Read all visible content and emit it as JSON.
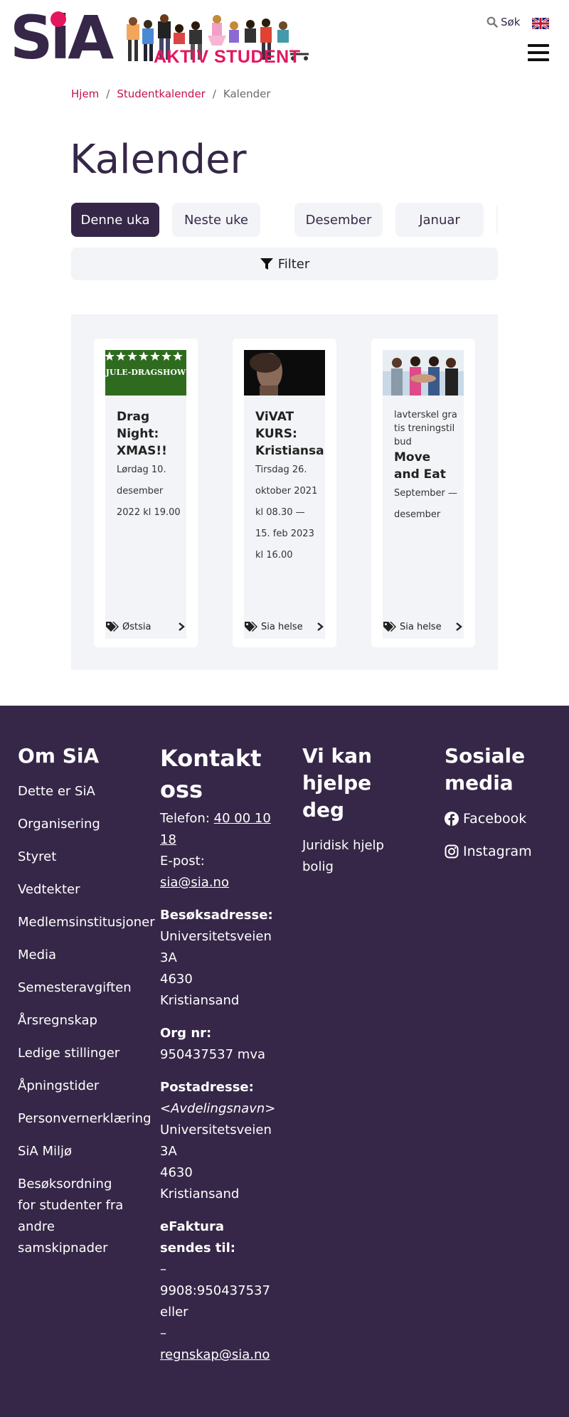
{
  "header": {
    "logo_text": "SiA",
    "banner_text": "AKTIV STUDENT",
    "search_label": "Søk"
  },
  "breadcrumb": {
    "home": "Hjem",
    "separator": "/",
    "studentkalender": "Studentkalender",
    "current": "Kalender"
  },
  "page_title": "Kalender",
  "tabs": [
    "Denne uka",
    "Neste uke",
    "Desember",
    "Januar"
  ],
  "filter_label": "Filter",
  "cards": [
    {
      "image_caption": "JULE-DRAGSHOW",
      "tag_text": "",
      "title": "Drag Night: XMAS!!",
      "date": "Lørdag 10. desember 2022 kl 19.00",
      "category": "Østsia"
    },
    {
      "image_caption": "",
      "tag_text": "",
      "title": "ViVAT KURS: Kristiansand",
      "date": "Tirsdag 26. oktober 2021 kl 08.30 — 15. feb 2023 kl 16.00",
      "category": "Sia helse"
    },
    {
      "image_caption": "",
      "tag_text": "lavterskel gratis treningstilbud",
      "title": "Move and Eat",
      "date": "September — desember",
      "category": "Sia helse"
    }
  ],
  "footer": {
    "om_sia": {
      "heading": "Om SiA",
      "links": [
        "Dette er SiA",
        "Organisering",
        "Styret",
        "Vedtekter",
        "Medlemsinstitusjoner",
        "Media",
        "Semesteravgiften",
        "Årsregnskap",
        "Ledige stillinger",
        "Åpningstider",
        "Personvernerklæring",
        "SiA Miljø",
        "Besøksordning for studenter fra andre samskipnader"
      ]
    },
    "kontakt": {
      "heading": "Kontakt oss",
      "phone_label": "Telefon:",
      "phone": "40 00 10 18",
      "email_label": "E-post:",
      "email": "sia@sia.no",
      "visit_label": "Besøksadresse:",
      "visit_street": "Universitetsveien 3A",
      "visit_city": "4630 Kristiansand",
      "org_label": "Org nr:",
      "org": "950437537 mva",
      "post_label": "Postadresse:",
      "post_dept": "<Avdelingsnavn>",
      "post_street": "Universitetsveien 3A",
      "post_city": "4630 Kristiansand",
      "efaktura_label": "eFaktura sendes til:",
      "efaktura_1": "– 9908:950437537",
      "efaktura_or": "eller",
      "efaktura_dash": "–",
      "efaktura_2": "regnskap@sia.no"
    },
    "hjelp": {
      "heading": "Vi kan hjelpe deg",
      "link": "Juridisk hjelp bolig"
    },
    "sosiale": {
      "heading": "Sosiale media",
      "facebook": "Facebook",
      "instagram": "Instagram"
    }
  }
}
